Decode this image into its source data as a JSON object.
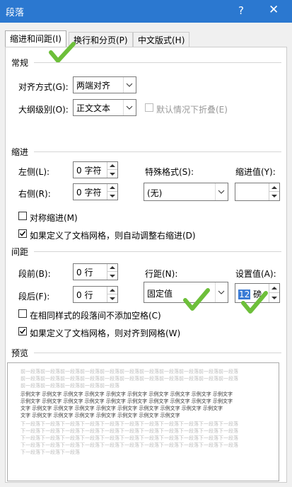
{
  "window": {
    "title": "段落",
    "help": "?",
    "close": "✕"
  },
  "tabs": [
    {
      "label": "缩进和间距(I)",
      "active": true
    },
    {
      "label": "换行和分页(P)",
      "active": false
    },
    {
      "label": "中文版式(H)",
      "active": false
    }
  ],
  "general": {
    "heading": "常规",
    "alignment": {
      "label": "对齐方式(G):",
      "value": "两端对齐"
    },
    "outline": {
      "label": "大纲级别(O):",
      "value": "正文文本"
    },
    "collapse": {
      "label": "默认情况下折叠(E)",
      "checked": false,
      "disabled": true
    }
  },
  "indent": {
    "heading": "缩进",
    "left": {
      "label": "左侧(L):",
      "value": "0 字符"
    },
    "right": {
      "label": "右侧(R):",
      "value": "0 字符"
    },
    "special": {
      "label": "特殊格式(S):",
      "value": "(无)"
    },
    "by": {
      "label": "缩进值(Y):",
      "value": ""
    },
    "mirror": {
      "label": "对称缩进(M)",
      "checked": false
    },
    "auto_right": {
      "label": "如果定义了文档网格，则自动调整右缩进(D)",
      "checked": true
    }
  },
  "spacing": {
    "heading": "间距",
    "before": {
      "label": "段前(B):",
      "value": "0 行"
    },
    "after": {
      "label": "段后(F):",
      "value": "0 行"
    },
    "line": {
      "label": "行距(N):",
      "value": "固定值"
    },
    "at": {
      "label": "设置值(A):",
      "value_number": "12",
      "value_unit": "磅"
    },
    "no_space_same": {
      "label": "在相同样式的段落间不添加空格(C)",
      "checked": false
    },
    "snap_grid": {
      "label": "如果定义了文档网格，则对齐到网格(W)",
      "checked": true
    }
  },
  "preview": {
    "heading": "预览",
    "prev_lines": [
      "前一段落前一段落前一段落前一段落前一段落前一段落前一段落前一段落前一段落前一段落前一段落",
      "前一段落前一段落前一段落前一段落前一段落前一段落前一段落前一段落前一段落前一段落前一段落",
      "前一段落前一段落前一段落前一段落前一段落"
    ],
    "sample_lines": [
      "示例文字 示例文字 示例文字 示例文字 示例文字 示例文字 示例文字 示例文字 示例文字 示例文字",
      "示例文字 示例文字 示例文字 示例文字 示例文字 示例文字 示例文字 示例文字 示例文字 示例文字",
      "文字 示例文字 示例文字 示例文字 示例文字 示例文字 示例文字 示例文字 示例文字 示例文字",
      "文字 示例文字 示例文字 示例文字 示例文字 示例文字 示例文字 示例文字"
    ],
    "next_lines": [
      "下一段落下一段落下一段落下一段落下一段落下一段落下一段落下一段落下一段落下一段落下一段落",
      "下一段落下一段落下一段落下一段落下一段落下一段落下一段落下一段落下一段落下一段落下一段落",
      "下一段落下一段落下一段落下一段落下一段落下一段落下一段落下一段落下一段落下一段落下一段落",
      "下一段落下一段落下一段落下一段落下一段落下一段落下一段落下一段落下一段落下一段落下一段落",
      "下一段落下一段落下一段落"
    ]
  },
  "colors": {
    "titlebar": "#2b78d0",
    "annotation": "#6dbf3a",
    "selection": "#3a7bd5"
  }
}
